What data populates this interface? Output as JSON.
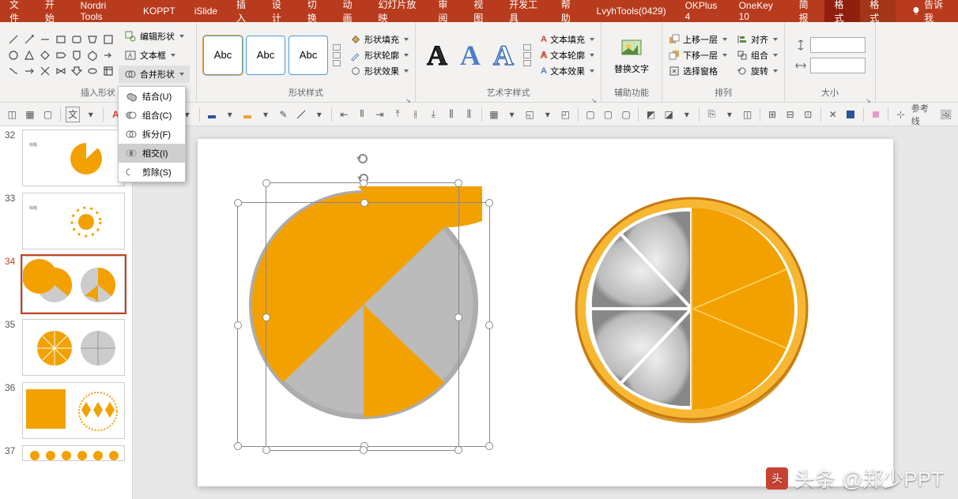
{
  "titlebar": {
    "tabs": [
      "文件",
      "开始",
      "Nordri Tools",
      "KOPPT",
      "iSlide",
      "插入",
      "设计",
      "切换",
      "动画",
      "幻灯片放映",
      "审阅",
      "视图",
      "开发工具",
      "帮助",
      "LvyhTools(0429)",
      "OKPlus 4",
      "OneKey 10",
      "简报",
      "格式",
      "格式"
    ],
    "active_tab_index": 18,
    "tell_me": "告诉我"
  },
  "ribbon": {
    "insert_shapes": {
      "label": "插入形状",
      "edit_shape": "编辑形状",
      "text_box": "文本框",
      "merge_shapes": "合并形状"
    },
    "merge_menu": {
      "items": [
        {
          "label": "结合(U)",
          "icon": "union"
        },
        {
          "label": "组合(C)",
          "icon": "combine"
        },
        {
          "label": "拆分(F)",
          "icon": "fragment"
        },
        {
          "label": "相交(I)",
          "icon": "intersect"
        },
        {
          "label": "剪除(S)",
          "icon": "subtract"
        }
      ],
      "hover_index": 3
    },
    "shape_styles": {
      "label": "形状样式",
      "abc": "Abc",
      "fill": "形状填充",
      "outline": "形状轮廓",
      "effects": "形状效果"
    },
    "wordart_styles": {
      "label": "艺术字样式",
      "fill": "文本填充",
      "outline": "文本轮廓",
      "effects": "文本效果"
    },
    "accessibility": {
      "label": "辅助功能",
      "alt_text": "替换文字"
    },
    "arrange": {
      "label": "排列",
      "bring_forward": "上移一层",
      "send_backward": "下移一层",
      "selection_pane": "选择窗格",
      "align": "对齐",
      "group": "组合",
      "rotate": "旋转"
    },
    "size": {
      "label": "大小"
    }
  },
  "quick_toolbar": {
    "guides_label": "参考线"
  },
  "thumbs": {
    "numbers": [
      "32",
      "33",
      "34",
      "35",
      "36",
      "37"
    ],
    "selected_index": 2
  },
  "watermark": {
    "prefix": "头条",
    "handle": "@郑少PPT"
  }
}
